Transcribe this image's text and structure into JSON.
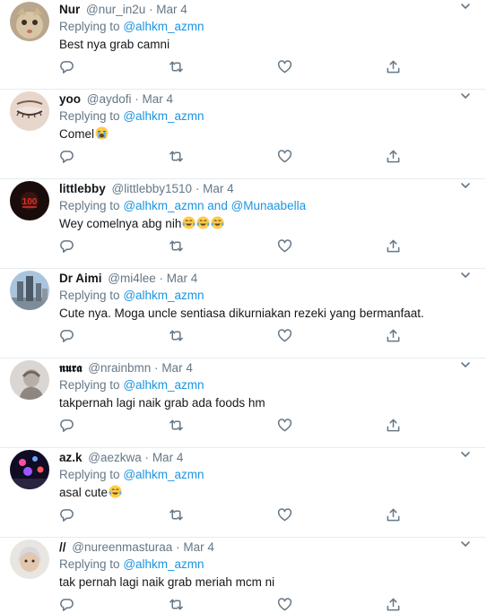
{
  "replying_label": "Replying to",
  "tweets": [
    {
      "display_name": "Nur",
      "handle": "@nur_in2u",
      "separator": "·",
      "time": "Mar 4",
      "mentions": "@alhkm_azmn",
      "text": "Best nya grab camni",
      "emoji": []
    },
    {
      "display_name": "yoo",
      "handle": "@aydofi",
      "separator": "·",
      "time": "Mar 4",
      "mentions": "@alhkm_azmn",
      "text": "Comel",
      "emoji": [
        "loudly-crying-face"
      ]
    },
    {
      "display_name": "littlebby",
      "handle": "@littlebby1510",
      "separator": "·",
      "time": "Mar 4",
      "mentions": "@alhkm_azmn and @Munaabella",
      "text": "Wey comelnya abg nih",
      "emoji": [
        "tears-of-joy",
        "tears-of-joy",
        "tears-of-joy"
      ]
    },
    {
      "display_name": "Dr Aimi",
      "handle": "@mi4lee",
      "separator": "·",
      "time": "Mar 4",
      "mentions": "@alhkm_azmn",
      "text": "Cute nya. Moga uncle sentiasa dikurniakan rezeki yang bermanfaat.",
      "emoji": []
    },
    {
      "display_name": "𝖓𝖚𝖗𝖆",
      "handle": "@nrainbmn",
      "separator": "·",
      "time": "Mar 4",
      "mentions": "@alhkm_azmn",
      "text": "takpernah lagi naik grab ada foods hm",
      "emoji": []
    },
    {
      "display_name": "az.k",
      "handle": "@aezkwa",
      "separator": "·",
      "time": "Mar 4",
      "mentions": "@alhkm_azmn",
      "text": "asal cute",
      "emoji": [
        "tears-of-joy"
      ]
    },
    {
      "display_name": "//",
      "handle": "@nureenmasturaa",
      "separator": "·",
      "time": "Mar 4",
      "mentions": "@alhkm_azmn",
      "text": "tak pernah lagi naik grab meriah mcm ni",
      "emoji": []
    }
  ],
  "icons": {
    "reply": "reply-icon",
    "retweet": "retweet-icon",
    "like": "heart-icon",
    "share": "share-icon",
    "more": "chevron-down-icon"
  },
  "colors": {
    "name": "#14171a",
    "secondary": "#657786",
    "link": "#1b95e0",
    "divider": "#e6ecf0"
  }
}
